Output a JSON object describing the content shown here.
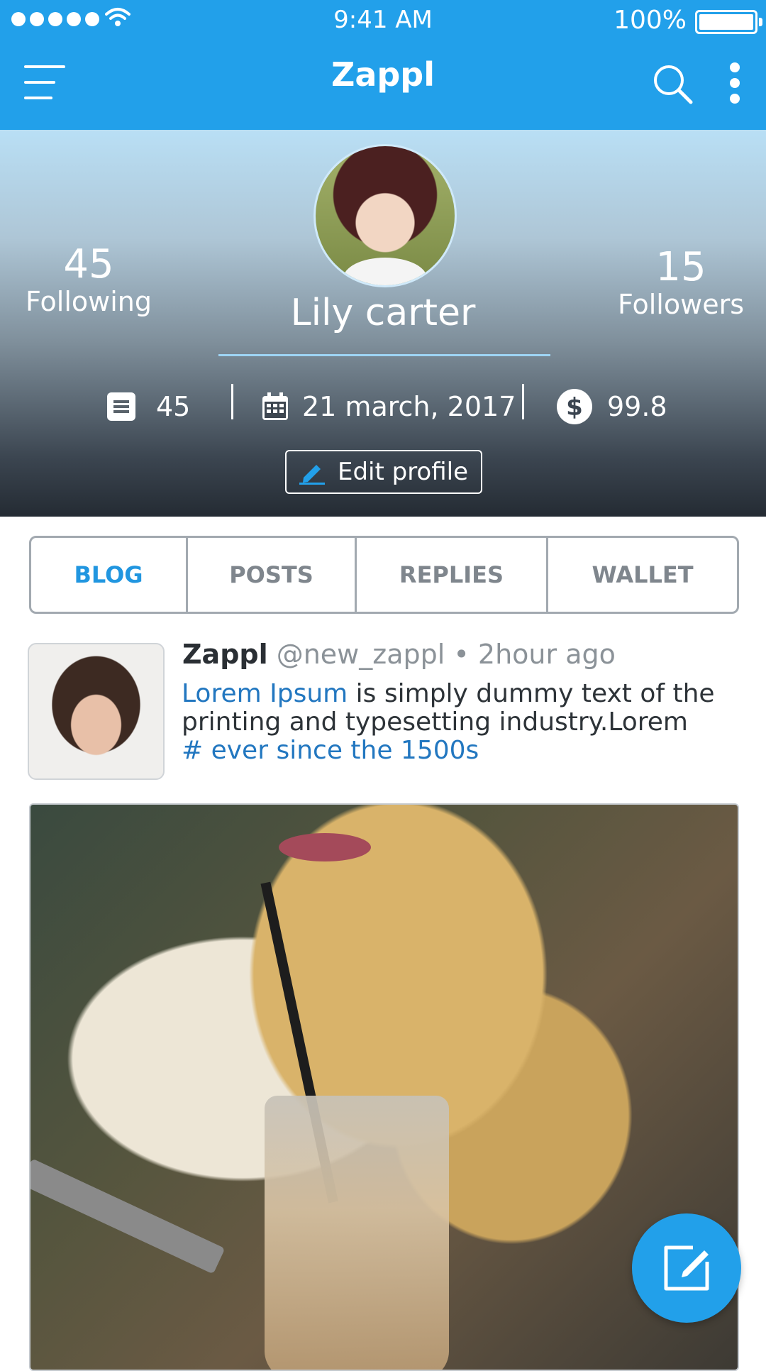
{
  "status_bar": {
    "time": "9:41 AM",
    "battery": "100%"
  },
  "app_bar": {
    "title": "Zappl"
  },
  "profile": {
    "name": "Lily carter",
    "following": {
      "count": "45",
      "label": "Following"
    },
    "followers": {
      "count": "15",
      "label": "Followers"
    },
    "posts_count": "45",
    "joined_date": "21 march, 2017",
    "balance": "99.8",
    "edit_label": "Edit profile"
  },
  "tabs": [
    {
      "label": "BLOG",
      "active": true
    },
    {
      "label": "POSTS",
      "active": false
    },
    {
      "label": "REPLIES",
      "active": false
    },
    {
      "label": "WALLET",
      "active": false
    }
  ],
  "post": {
    "author": "Zappl",
    "handle": "@new_zappl",
    "separator": "•",
    "time": "2hour ago",
    "link_text": "Lorem Ipsum",
    "text": " is simply dummy text of the printing and typesetting industry.Lorem",
    "hashtag": "# ever since the 1500s"
  },
  "colors": {
    "accent": "#22a0ea",
    "link": "#2277c0",
    "active_tab": "#2196e0"
  },
  "icons": [
    "menu-icon",
    "search-icon",
    "more-vertical-icon",
    "document-icon",
    "calendar-icon",
    "dollar-icon",
    "pencil-icon",
    "compose-icon"
  ]
}
